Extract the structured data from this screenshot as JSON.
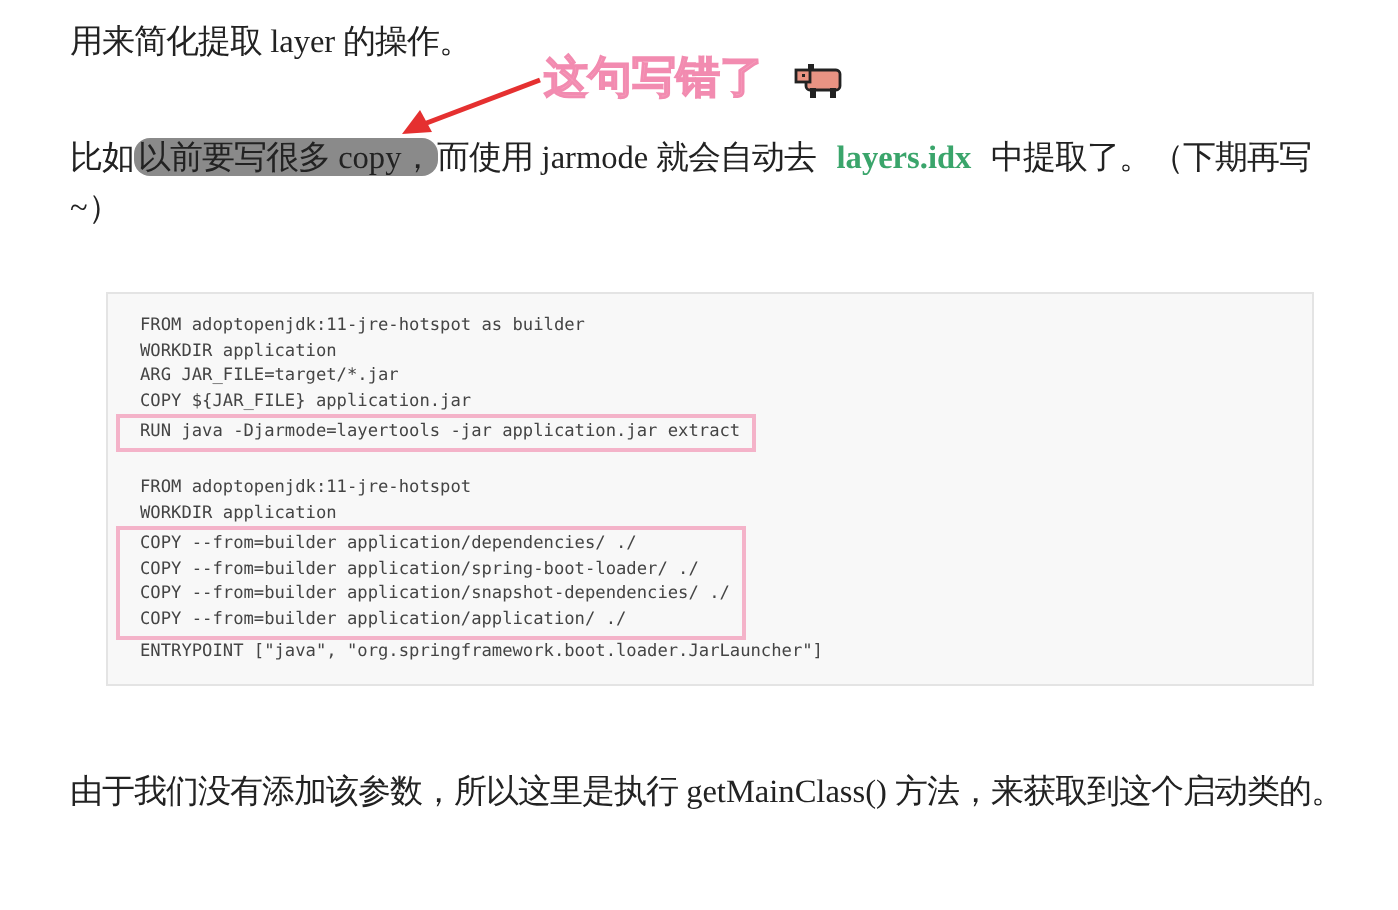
{
  "paragraphs": [
    {
      "segments": [
        {
          "kind": "plain",
          "text": "用来简化提取 layer 的操作。"
        }
      ]
    },
    {
      "segments": [
        {
          "kind": "plain",
          "text": "比如"
        },
        {
          "kind": "marked",
          "text": "以前要写很多 copy，"
        },
        {
          "kind": "plain",
          "text": "而使用 jarmode 就会自动去 "
        },
        {
          "kind": "keyword",
          "text": "layers.idx"
        },
        {
          "kind": "plain",
          "text": " 中提取了。（下期再写~）"
        }
      ]
    }
  ],
  "annotation": {
    "text": "这句写错了"
  },
  "code_image": {
    "blocks": [
      {
        "boxed": false,
        "gap_before": false,
        "lines": [
          "FROM adoptopenjdk:11-jre-hotspot as builder",
          "WORKDIR application",
          "ARG JAR_FILE=target/*.jar",
          "COPY ${JAR_FILE} application.jar"
        ]
      },
      {
        "boxed": true,
        "gap_before": false,
        "lines": [
          "RUN java -Djarmode=layertools -jar application.jar extract"
        ]
      },
      {
        "boxed": false,
        "gap_before": true,
        "lines": [
          "FROM adoptopenjdk:11-jre-hotspot",
          "WORKDIR application"
        ]
      },
      {
        "boxed": true,
        "gap_before": false,
        "lines": [
          "COPY --from=builder application/dependencies/ ./",
          "COPY --from=builder application/spring-boot-loader/ ./",
          "COPY --from=builder application/snapshot-dependencies/ ./",
          "COPY --from=builder application/application/ ./"
        ]
      },
      {
        "boxed": false,
        "gap_before": false,
        "lines": [
          "ENTRYPOINT [\"java\", \"org.springframework.boot.loader.JarLauncher\"]"
        ]
      }
    ]
  },
  "closing_paragraph": {
    "text": "由于我们没有添加该参数，所以这里是执行 getMainClass() 方法，来获取到这个启动类的。"
  }
}
